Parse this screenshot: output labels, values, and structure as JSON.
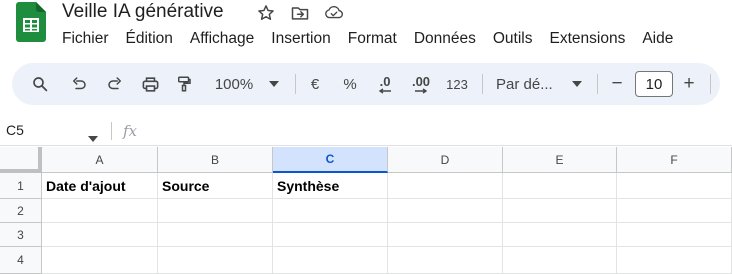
{
  "app": {
    "doc_title": "Veille IA générative",
    "icons": [
      "sheets-logo",
      "star-icon",
      "move-folder-icon",
      "cloud-status-icon"
    ]
  },
  "menu": [
    "Fichier",
    "Édition",
    "Affichage",
    "Insertion",
    "Format",
    "Données",
    "Outils",
    "Extensions",
    "Aide"
  ],
  "toolbar": {
    "zoom": "100%",
    "currency": "€",
    "percent": "%",
    "decrease_decimals": ".0",
    "increase_decimals": ".00",
    "number_format": "123",
    "font": "Par dé...",
    "minus": "−",
    "font_size": "10",
    "plus": "+"
  },
  "formula_bar": {
    "name_box": "C5",
    "fx": "fx",
    "value": ""
  },
  "grid": {
    "columns": [
      "A",
      "B",
      "C",
      "D",
      "E",
      "F"
    ],
    "selected_column": "C",
    "rows": [
      "1",
      "2",
      "3",
      "4"
    ],
    "cells": {
      "A1": "Date d'ajout",
      "B1": "Source",
      "C1": "Synthèse"
    }
  },
  "colors": {
    "toolbar_bg": "#edf2fa",
    "selected_header": "#d3e3fd",
    "accent": "#0b57d0",
    "sheets_green": "#1e8e3e"
  }
}
